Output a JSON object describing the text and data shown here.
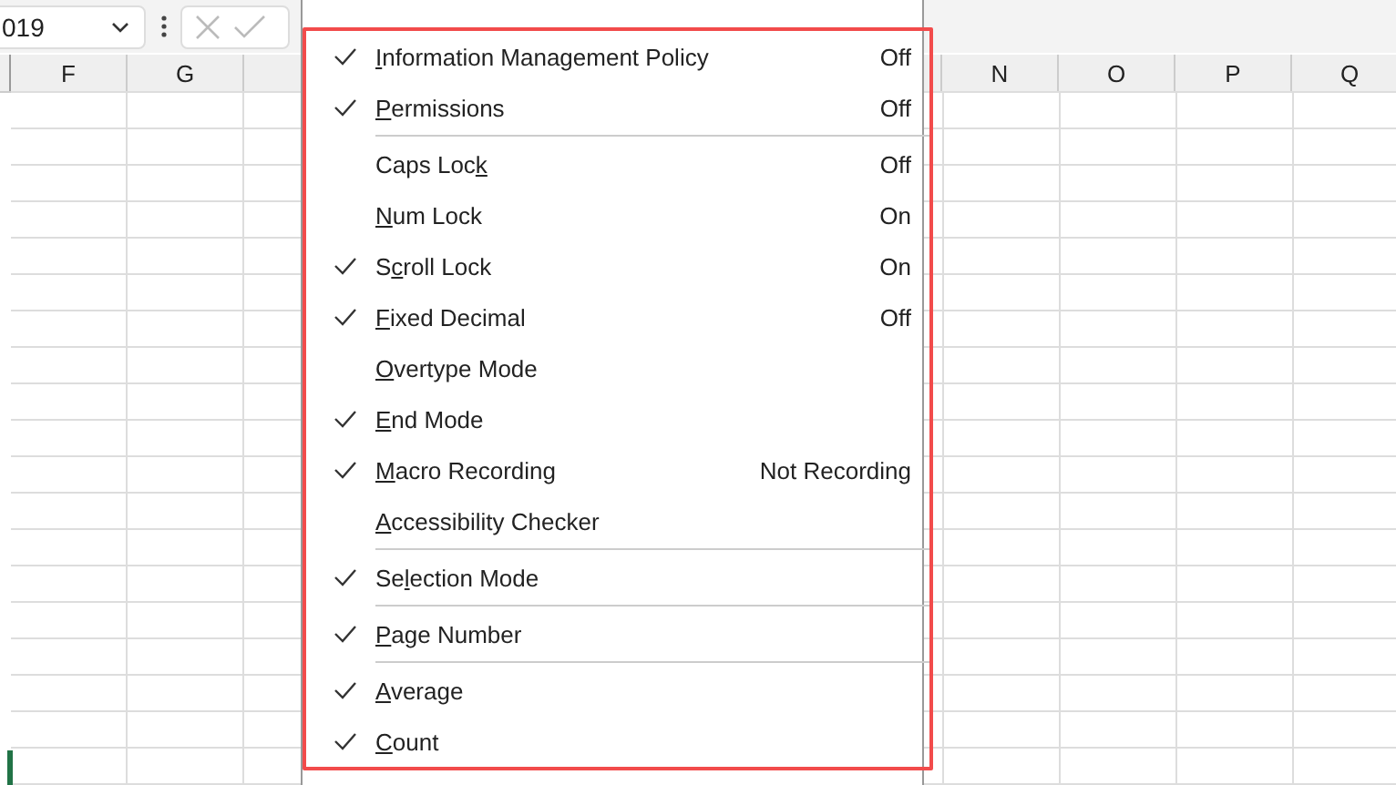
{
  "name_box": {
    "value": "019"
  },
  "columns_left": [
    "F",
    "G"
  ],
  "columns_right": [
    "N",
    "O",
    "P",
    "Q"
  ],
  "menu": [
    {
      "kind": "item",
      "checked": true,
      "key": "I",
      "post": "nformation Management Policy",
      "value": "Off"
    },
    {
      "kind": "item",
      "checked": true,
      "key": "P",
      "post": "ermissions",
      "value": "Off"
    },
    {
      "kind": "separator"
    },
    {
      "kind": "item",
      "checked": false,
      "pre": "Caps Loc",
      "key": "k",
      "value": "Off"
    },
    {
      "kind": "item",
      "checked": false,
      "key": "N",
      "post": "um Lock",
      "value": "On"
    },
    {
      "kind": "item",
      "checked": true,
      "pre": "S",
      "key": "c",
      "post": "roll Lock",
      "value": "On"
    },
    {
      "kind": "item",
      "checked": true,
      "key": "F",
      "post": "ixed Decimal",
      "value": "Off"
    },
    {
      "kind": "item",
      "checked": false,
      "key": "O",
      "post": "vertype Mode"
    },
    {
      "kind": "item",
      "checked": true,
      "key": "E",
      "post": "nd Mode"
    },
    {
      "kind": "item",
      "checked": true,
      "key": "M",
      "post": "acro Recording",
      "value": "Not Recording"
    },
    {
      "kind": "item",
      "checked": false,
      "key": "A",
      "post": "ccessibility Checker"
    },
    {
      "kind": "separator"
    },
    {
      "kind": "item",
      "checked": true,
      "pre": "Se",
      "key": "l",
      "post": "ection Mode"
    },
    {
      "kind": "separator"
    },
    {
      "kind": "item",
      "checked": true,
      "key": "P",
      "post": "age Number"
    },
    {
      "kind": "separator"
    },
    {
      "kind": "item",
      "checked": true,
      "key": "A",
      "post": "verage"
    },
    {
      "kind": "item",
      "checked": true,
      "key": "C",
      "post": "ount"
    }
  ]
}
